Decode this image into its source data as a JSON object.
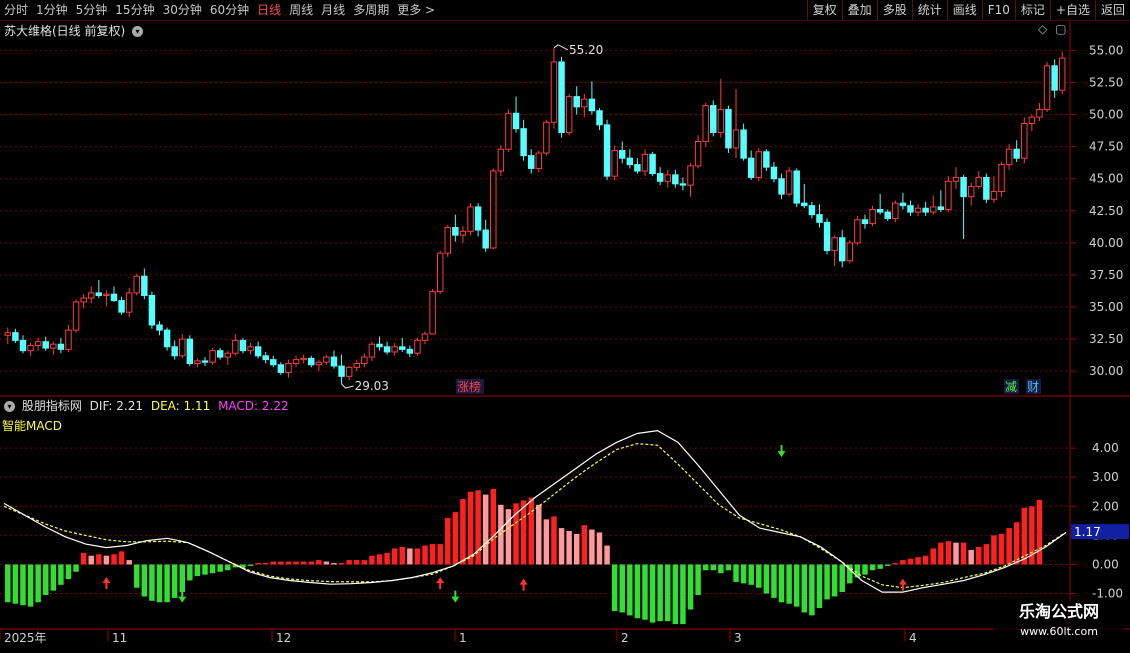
{
  "toolbar": {
    "timeframes": [
      "分时",
      "1分钟",
      "5分钟",
      "15分钟",
      "30分钟",
      "60分钟",
      "日线",
      "周线",
      "月线",
      "多周期",
      "更多 >"
    ],
    "active_index": 6,
    "right_buttons": [
      "复权",
      "叠加",
      "多股",
      "统计",
      "画线",
      "F10",
      "标记",
      "+自选",
      "返回"
    ]
  },
  "price_panel": {
    "title": "苏大维格(日线 前复权)",
    "axis_labels": [
      "55.00",
      "52.50",
      "50.00",
      "47.50",
      "45.00",
      "42.50",
      "40.00",
      "37.50",
      "35.00",
      "32.50",
      "30.00"
    ],
    "high_label": "55.20",
    "low_label": "29.03",
    "tags": [
      {
        "text": "涨榜",
        "color": "#ff4040"
      },
      {
        "text": "减",
        "color": "#40ff40"
      },
      {
        "text": "财",
        "color": "#40c0ff"
      }
    ]
  },
  "indicator_panel": {
    "name": "股朋指标网",
    "dif_label": "DIF: 2.21",
    "dea_label": "DEA: 1.11",
    "macd_label": "MACD: 2.22",
    "subtitle": "智能MACD",
    "axis_labels": [
      "4.00",
      "3.00",
      "2.00",
      "1.00",
      "0.00",
      "-1.00"
    ],
    "current_value": "1.17"
  },
  "date_axis": [
    "2025年",
    "11",
    "12",
    "1",
    "2",
    "3",
    "4"
  ],
  "watermark": {
    "line1": "乐淘公式网",
    "line2": "www.60lt.com"
  },
  "colors": {
    "up": "#ff3b3b",
    "down": "#54ffff",
    "up_hist": "#ff2020",
    "up_hist_weak": "#ff9a9a",
    "down_hist": "#30e030",
    "dea": "#ffff40",
    "dif": "#ffffff",
    "grid": "#7a0000"
  },
  "chart_data": {
    "type": "candlestick",
    "price_candles_ohlc": [
      [
        32.8,
        33.4,
        32.1,
        33.0
      ],
      [
        33.0,
        33.3,
        32.2,
        32.4
      ],
      [
        32.4,
        32.8,
        31.4,
        31.6
      ],
      [
        31.6,
        32.2,
        31.2,
        32.0
      ],
      [
        32.0,
        32.6,
        31.6,
        32.3
      ],
      [
        32.3,
        32.7,
        31.6,
        31.8
      ],
      [
        31.8,
        32.3,
        31.3,
        32.1
      ],
      [
        32.1,
        32.6,
        31.4,
        31.7
      ],
      [
        31.7,
        33.6,
        31.5,
        33.2
      ],
      [
        33.2,
        35.6,
        33.0,
        35.4
      ],
      [
        35.4,
        36.0,
        34.9,
        35.7
      ],
      [
        35.7,
        36.6,
        35.3,
        36.1
      ],
      [
        36.1,
        37.1,
        35.7,
        35.9
      ],
      [
        35.9,
        36.3,
        35.1,
        36.0
      ],
      [
        36.0,
        36.6,
        35.4,
        35.5
      ],
      [
        35.5,
        35.8,
        34.4,
        34.6
      ],
      [
        34.6,
        36.5,
        34.2,
        36.1
      ],
      [
        36.1,
        37.6,
        35.9,
        37.4
      ],
      [
        37.4,
        38.0,
        35.6,
        35.9
      ],
      [
        35.9,
        36.2,
        33.3,
        33.6
      ],
      [
        33.6,
        33.9,
        32.8,
        33.2
      ],
      [
        33.2,
        33.4,
        31.6,
        31.9
      ],
      [
        31.9,
        32.4,
        30.9,
        31.2
      ],
      [
        31.2,
        32.9,
        31.0,
        32.5
      ],
      [
        32.5,
        32.8,
        30.4,
        30.6
      ],
      [
        30.6,
        31.0,
        30.3,
        30.8
      ],
      [
        30.8,
        31.1,
        30.4,
        30.7
      ],
      [
        30.7,
        31.8,
        30.5,
        31.6
      ],
      [
        31.6,
        31.8,
        30.9,
        31.1
      ],
      [
        31.1,
        31.6,
        30.5,
        31.4
      ],
      [
        31.4,
        32.9,
        31.2,
        32.4
      ],
      [
        32.4,
        32.6,
        31.4,
        31.6
      ],
      [
        31.6,
        32.2,
        31.3,
        31.9
      ],
      [
        31.9,
        32.3,
        31.0,
        31.2
      ],
      [
        31.2,
        31.5,
        30.6,
        30.9
      ],
      [
        30.9,
        31.2,
        30.3,
        30.5
      ],
      [
        30.5,
        30.7,
        29.7,
        29.9
      ],
      [
        29.9,
        30.9,
        29.5,
        30.6
      ],
      [
        30.6,
        31.2,
        30.3,
        30.9
      ],
      [
        30.9,
        31.3,
        30.6,
        31.0
      ],
      [
        31.0,
        31.2,
        30.3,
        30.5
      ],
      [
        30.5,
        30.9,
        30.0,
        30.7
      ],
      [
        30.7,
        31.3,
        30.5,
        31.1
      ],
      [
        31.1,
        31.6,
        30.2,
        30.4
      ],
      [
        30.4,
        31.3,
        29.0,
        29.6
      ],
      [
        29.6,
        30.4,
        29.3,
        30.3
      ],
      [
        30.3,
        30.9,
        30.0,
        30.6
      ],
      [
        30.6,
        31.4,
        30.3,
        31.1
      ],
      [
        31.1,
        32.3,
        30.8,
        32.1
      ],
      [
        32.1,
        32.7,
        31.6,
        31.9
      ],
      [
        31.9,
        32.3,
        31.3,
        31.5
      ],
      [
        31.5,
        32.2,
        31.2,
        31.9
      ],
      [
        31.9,
        32.6,
        31.5,
        31.7
      ],
      [
        31.7,
        32.0,
        31.1,
        31.4
      ],
      [
        31.4,
        32.6,
        31.2,
        32.4
      ],
      [
        32.4,
        33.1,
        32.1,
        32.9
      ],
      [
        32.9,
        36.4,
        34.9,
        36.2
      ],
      [
        36.2,
        39.4,
        36.0,
        39.2
      ],
      [
        39.2,
        41.4,
        38.9,
        41.2
      ],
      [
        41.2,
        42.2,
        40.1,
        40.6
      ],
      [
        40.6,
        41.3,
        40.0,
        40.9
      ],
      [
        40.9,
        43.1,
        40.6,
        42.8
      ],
      [
        42.8,
        43.1,
        40.5,
        41.0
      ],
      [
        41.0,
        41.8,
        39.3,
        39.6
      ],
      [
        39.6,
        45.8,
        39.5,
        45.6
      ],
      [
        45.6,
        47.6,
        45.2,
        47.3
      ],
      [
        47.3,
        50.4,
        47.1,
        50.1
      ],
      [
        50.1,
        51.4,
        48.6,
        48.9
      ],
      [
        48.9,
        49.6,
        46.4,
        46.8
      ],
      [
        46.8,
        47.3,
        45.4,
        45.8
      ],
      [
        45.8,
        47.2,
        45.5,
        47.0
      ],
      [
        47.0,
        49.6,
        46.8,
        49.4
      ],
      [
        49.4,
        55.2,
        48.9,
        54.1
      ],
      [
        54.1,
        54.5,
        48.2,
        48.6
      ],
      [
        48.6,
        51.6,
        48.4,
        51.4
      ],
      [
        51.4,
        52.2,
        50.0,
        50.6
      ],
      [
        50.6,
        51.6,
        49.8,
        51.2
      ],
      [
        51.2,
        52.6,
        50.0,
        50.3
      ],
      [
        50.3,
        50.5,
        48.8,
        49.2
      ],
      [
        49.2,
        49.6,
        44.9,
        45.2
      ],
      [
        45.2,
        47.6,
        44.9,
        47.2
      ],
      [
        47.2,
        47.9,
        46.2,
        46.6
      ],
      [
        46.6,
        47.3,
        45.8,
        46.1
      ],
      [
        46.1,
        46.6,
        45.4,
        45.6
      ],
      [
        45.6,
        47.3,
        45.2,
        46.9
      ],
      [
        46.9,
        47.1,
        45.2,
        45.4
      ],
      [
        45.4,
        45.9,
        44.5,
        44.8
      ],
      [
        44.8,
        45.7,
        44.3,
        45.3
      ],
      [
        45.3,
        45.7,
        44.3,
        44.6
      ],
      [
        44.6,
        45.1,
        44.1,
        44.5
      ],
      [
        44.5,
        46.2,
        43.6,
        46.0
      ],
      [
        46.0,
        48.4,
        45.8,
        47.9
      ],
      [
        47.9,
        50.9,
        47.5,
        50.7
      ],
      [
        50.7,
        51.1,
        48.3,
        48.6
      ],
      [
        48.6,
        52.8,
        48.2,
        50.4
      ],
      [
        50.4,
        50.7,
        47.0,
        47.4
      ],
      [
        47.4,
        52.0,
        46.6,
        48.8
      ],
      [
        48.8,
        49.3,
        46.4,
        46.6
      ],
      [
        46.6,
        47.2,
        44.9,
        45.1
      ],
      [
        45.1,
        47.4,
        44.8,
        47.1
      ],
      [
        47.1,
        47.3,
        45.6,
        45.9
      ],
      [
        45.9,
        46.3,
        44.7,
        45.0
      ],
      [
        45.0,
        45.4,
        43.4,
        43.8
      ],
      [
        43.8,
        45.9,
        43.6,
        45.6
      ],
      [
        45.6,
        45.8,
        42.8,
        43.1
      ],
      [
        43.1,
        44.6,
        42.7,
        42.9
      ],
      [
        42.9,
        43.2,
        41.9,
        42.2
      ],
      [
        42.2,
        43.0,
        41.2,
        41.6
      ],
      [
        41.6,
        41.9,
        39.1,
        39.4
      ],
      [
        39.4,
        40.6,
        38.2,
        40.4
      ],
      [
        40.4,
        41.0,
        38.1,
        38.6
      ],
      [
        38.6,
        40.2,
        38.4,
        40.0
      ],
      [
        40.0,
        42.1,
        39.8,
        41.8
      ],
      [
        41.8,
        42.2,
        41.1,
        41.5
      ],
      [
        41.5,
        42.9,
        41.3,
        42.6
      ],
      [
        42.6,
        43.8,
        42.2,
        42.4
      ],
      [
        42.4,
        42.6,
        41.7,
        41.9
      ],
      [
        41.9,
        43.3,
        41.6,
        43.1
      ],
      [
        43.1,
        43.9,
        42.6,
        42.9
      ],
      [
        42.9,
        43.3,
        42.1,
        42.4
      ],
      [
        42.4,
        43.0,
        42.1,
        42.7
      ],
      [
        42.7,
        43.2,
        42.1,
        42.4
      ],
      [
        42.4,
        43.7,
        42.2,
        42.8
      ],
      [
        42.8,
        44.1,
        42.4,
        42.6
      ],
      [
        42.6,
        45.2,
        42.4,
        44.8
      ],
      [
        44.8,
        45.9,
        44.2,
        45.1
      ],
      [
        45.1,
        45.3,
        40.3,
        43.6
      ],
      [
        43.6,
        44.7,
        42.9,
        44.4
      ],
      [
        44.4,
        45.6,
        44.2,
        45.1
      ],
      [
        45.1,
        45.4,
        43.1,
        43.4
      ],
      [
        43.4,
        45.2,
        43.1,
        44.0
      ],
      [
        44.0,
        46.3,
        43.6,
        46.1
      ],
      [
        46.1,
        47.7,
        45.7,
        47.3
      ],
      [
        47.3,
        48.0,
        46.3,
        46.6
      ],
      [
        46.6,
        49.8,
        46.2,
        49.3
      ],
      [
        49.3,
        50.0,
        48.7,
        49.8
      ],
      [
        49.8,
        50.9,
        49.5,
        50.4
      ],
      [
        50.4,
        54.1,
        50.2,
        53.8
      ],
      [
        53.8,
        54.3,
        51.3,
        51.9
      ],
      [
        51.9,
        54.9,
        51.6,
        54.4
      ]
    ],
    "indicator_values": {
      "dif": [
        2.1,
        1.7,
        1.3,
        0.95,
        0.7,
        0.58,
        0.65,
        0.82,
        0.9,
        0.75,
        0.45,
        0.1,
        -0.25,
        -0.45,
        -0.55,
        -0.62,
        -0.68,
        -0.66,
        -0.62,
        -0.55,
        -0.45,
        -0.28,
        -0.05,
        0.35,
        1.0,
        1.7,
        2.3,
        2.8,
        3.3,
        3.8,
        4.2,
        4.5,
        4.6,
        4.2,
        3.4,
        2.55,
        1.7,
        1.25,
        1.1,
        0.95,
        0.6,
        0.1,
        -0.55,
        -0.95,
        -0.95,
        -0.8,
        -0.68,
        -0.55,
        -0.35,
        -0.1,
        0.2,
        0.6,
        1.1
      ],
      "dea": [
        2.0,
        1.7,
        1.4,
        1.15,
        1.0,
        0.85,
        0.78,
        0.78,
        0.8,
        0.75,
        0.45,
        0.1,
        -0.2,
        -0.4,
        -0.5,
        -0.56,
        -0.59,
        -0.6,
        -0.6,
        -0.56,
        -0.45,
        -0.33,
        -0.05,
        0.3,
        0.9,
        1.4,
        1.9,
        2.45,
        3.0,
        3.5,
        3.95,
        4.15,
        4.1,
        3.45,
        2.75,
        2.05,
        1.6,
        1.4,
        1.2,
        0.95,
        0.55,
        0.1,
        -0.4,
        -0.7,
        -0.8,
        -0.72,
        -0.62,
        -0.45,
        -0.3,
        -0.05,
        0.3,
        0.65,
        1.11
      ],
      "macd_hist": [
        -1.3,
        -1.35,
        -1.4,
        -1.45,
        -1.3,
        -1.05,
        -0.9,
        -0.7,
        -0.5,
        -0.25,
        0.4,
        0.3,
        0.35,
        0.3,
        0.35,
        0.45,
        0.15,
        -0.8,
        -1.1,
        -1.25,
        -1.3,
        -1.3,
        -1.15,
        -0.95,
        -0.55,
        -0.4,
        -0.35,
        -0.3,
        -0.25,
        -0.2,
        -0.1,
        -0.1,
        -0.05,
        0.05,
        0.05,
        0.1,
        0.1,
        0.1,
        0.1,
        0.1,
        0.1,
        0.15,
        0.1,
        0.05,
        0.05,
        0.15,
        0.15,
        0.15,
        0.3,
        0.35,
        0.4,
        0.55,
        0.6,
        0.55,
        0.55,
        0.65,
        0.7,
        0.7,
        1.6,
        1.8,
        2.25,
        2.5,
        2.55,
        2.4,
        2.6,
        2.05,
        1.9,
        2.1,
        2.2,
        2.3,
        2.05,
        1.55,
        1.65,
        1.25,
        1.15,
        1.05,
        1.35,
        1.2,
        1.1,
        0.65,
        -1.6,
        -1.65,
        -1.75,
        -1.85,
        -1.9,
        -2.0,
        -1.95,
        -1.95,
        -2.05,
        -2.05,
        -1.55,
        -1.05,
        -0.2,
        -0.2,
        -0.3,
        -0.2,
        -0.6,
        -0.65,
        -0.7,
        -0.8,
        -1.0,
        -1.15,
        -1.3,
        -1.35,
        -1.45,
        -1.65,
        -1.75,
        -1.5,
        -1.2,
        -1.1,
        -0.95,
        -0.65,
        -0.45,
        -0.35,
        -0.2,
        -0.15,
        -0.05,
        0.05,
        0.15,
        0.2,
        0.25,
        0.3,
        0.55,
        0.75,
        0.8,
        0.75,
        0.75,
        0.5,
        0.6,
        0.7,
        1.0,
        1.05,
        1.25,
        1.45,
        1.95,
        2.0,
        2.22
      ],
      "buy_arrows": [
        13,
        57,
        68,
        118
      ],
      "sell_arrows": [
        23,
        59,
        102
      ]
    },
    "ylim_price": [
      28.3,
      56.2
    ],
    "ylim_indicator": [
      -2.15,
      5.0
    ]
  }
}
